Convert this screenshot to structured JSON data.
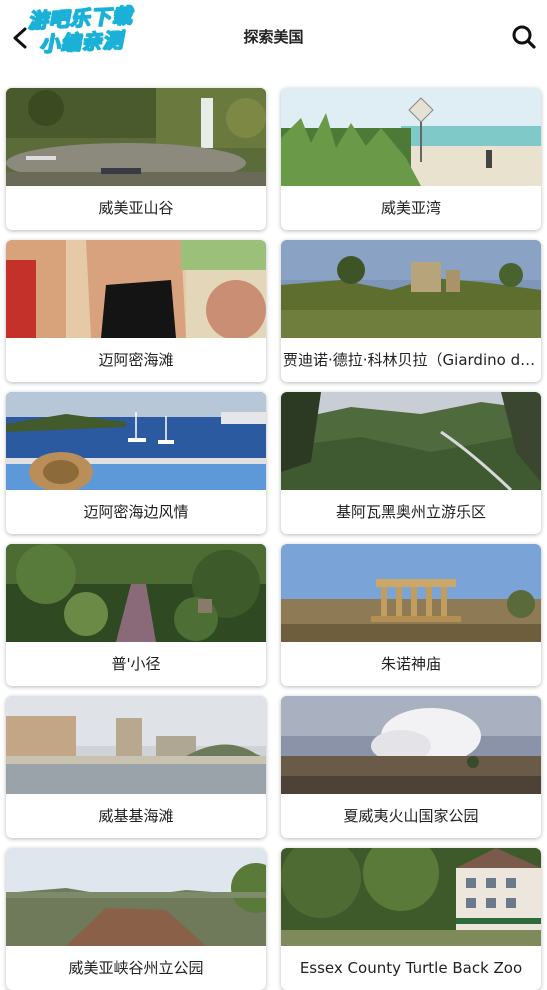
{
  "header": {
    "title": "探索美国",
    "watermark_line1": "游吧乐下载",
    "watermark_line2": "小编亲测"
  },
  "places": [
    {
      "name": "威美亚山谷"
    },
    {
      "name": "威美亚湾"
    },
    {
      "name": "迈阿密海滩"
    },
    {
      "name": "贾迪诺·德拉·科林贝拉（Giardino della Collina Bella）"
    },
    {
      "name": "迈阿密海边风情"
    },
    {
      "name": "基阿瓦黑奥州立游乐区"
    },
    {
      "name": "普'小径"
    },
    {
      "name": "朱诺神庙"
    },
    {
      "name": "威基基海滩"
    },
    {
      "name": "夏威夷火山国家公园"
    },
    {
      "name": "威美亚峡谷州立公园"
    },
    {
      "name": "Essex County Turtle Back Zoo"
    }
  ]
}
